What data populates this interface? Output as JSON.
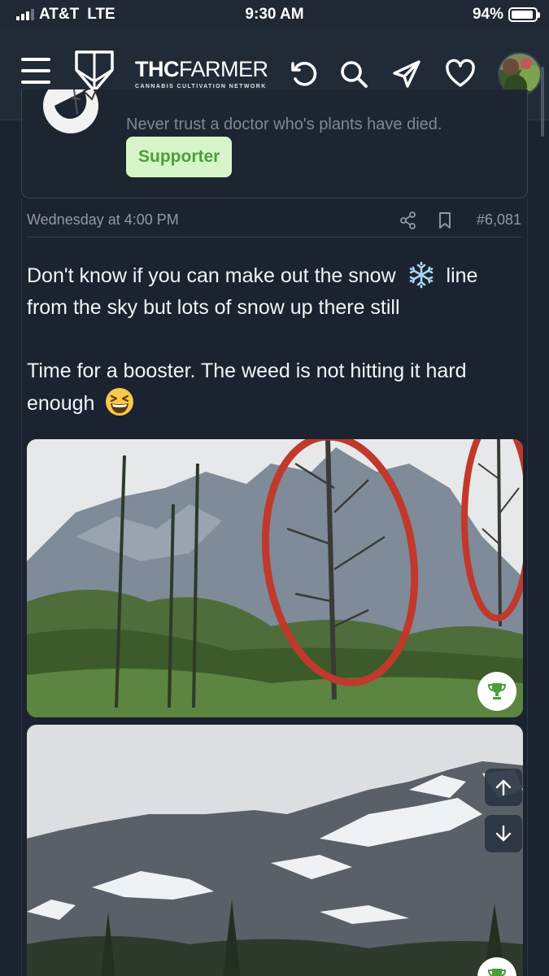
{
  "status_bar": {
    "carrier": "AT&T",
    "network": "LTE",
    "time": "9:30 AM",
    "battery": "94%",
    "battery_level": 0.94
  },
  "header": {
    "brand_bold": "THC",
    "brand_light": "FARMER",
    "tagline": "CANNABIS CULTIVATION NETWORK",
    "icons": [
      "menu-icon",
      "logo-icon",
      "refresh-icon",
      "search-icon",
      "send-icon",
      "heart-icon",
      "avatar"
    ]
  },
  "previous_post": {
    "signature": "Never trust a doctor who's plants have died.",
    "badge": "Supporter"
  },
  "post": {
    "date": "Wednesday at 4:00 PM",
    "number": "#6,081",
    "paragraph1_a": "Don't know if you can make out the snow",
    "paragraph1_b": "line from the sky but lots of snow up there still",
    "paragraph2": "Time for a booster. The weed is not hitting it hard enough",
    "emojis": [
      "snowflake-emoji",
      "laughing-emoji"
    ]
  },
  "colors": {
    "background": "#1b2330",
    "header": "#212b38",
    "badge_bg": "#d6f5c9",
    "badge_text": "#4e9d3b",
    "annotation_red": "#c0392b",
    "trophy_green": "#4e9d3b"
  }
}
